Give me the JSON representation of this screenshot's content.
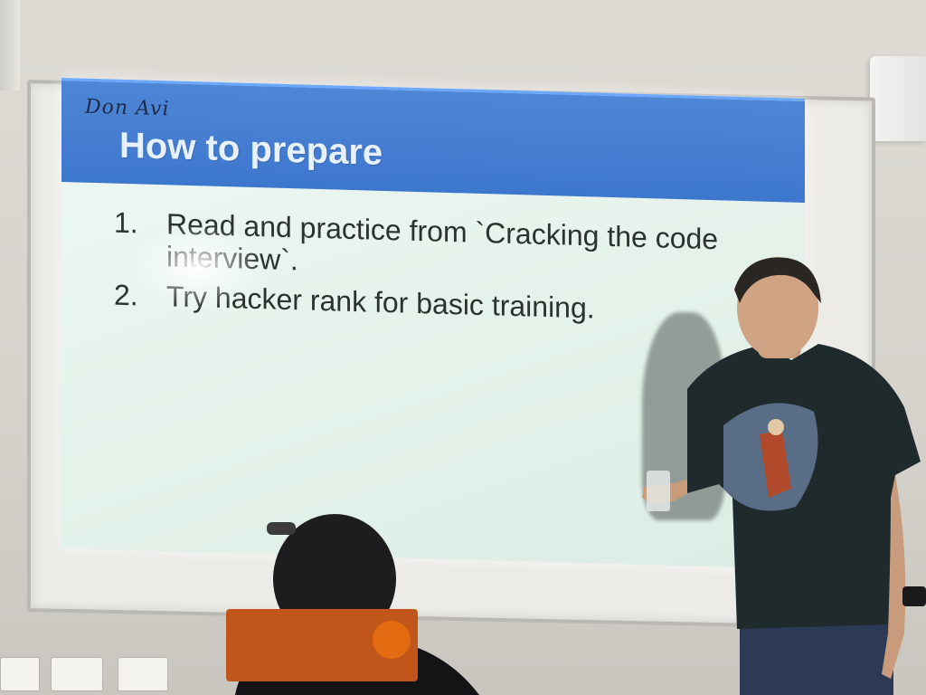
{
  "slide": {
    "handwriting": "Don Avi",
    "title": "How to prepare",
    "items": [
      {
        "number": "1.",
        "text": "Read and practice from `Cracking the code interview`."
      },
      {
        "number": "2.",
        "text": "Try hacker rank for basic training."
      }
    ]
  },
  "colors": {
    "header": "#3d77cd",
    "slide_background": "#e4f2ea",
    "shirt": "#1f2a2c",
    "wall": "#d9d6d0"
  }
}
